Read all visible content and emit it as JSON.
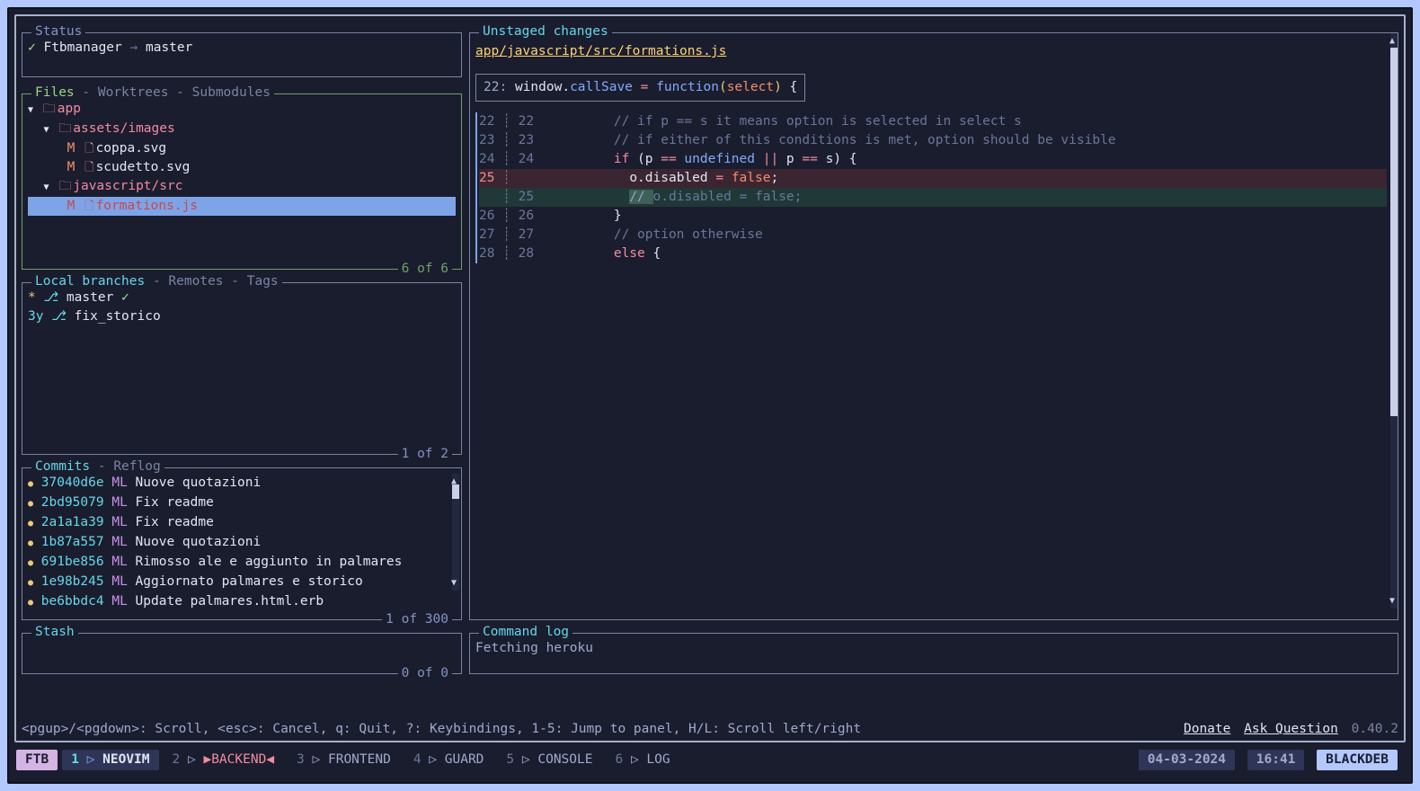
{
  "status": {
    "title": "Status",
    "repo": "Ftbmanager",
    "arrow": "→",
    "branch": "master"
  },
  "files": {
    "tabs": {
      "active": "Files",
      "t2": "Worktrees",
      "t3": "Submodules"
    },
    "counter": "6 of 6",
    "tree": {
      "app": "app",
      "assets": "assets/images",
      "coppa": "coppa.svg",
      "scudetto": "scudetto.svg",
      "jssrc": "javascript/src",
      "formations": "formations.js"
    },
    "status_m": "M"
  },
  "branches": {
    "tabs": {
      "active": "Local branches",
      "t2": "Remotes",
      "t3": "Tags"
    },
    "counter": "1 of 2",
    "items": [
      {
        "prefix": "*",
        "name": "master",
        "check": "✓",
        "age": ""
      },
      {
        "prefix": "",
        "name": "fix_storico",
        "check": "",
        "age": "3y"
      }
    ]
  },
  "commits": {
    "tabs": {
      "active": "Commits",
      "t2": "Reflog"
    },
    "counter": "1 of 300",
    "items": [
      {
        "hash": "37040d6e",
        "author": "ML",
        "msg": "Nuove quotazioni"
      },
      {
        "hash": "2bd95079",
        "author": "ML",
        "msg": "Fix readme"
      },
      {
        "hash": "2a1a1a39",
        "author": "ML",
        "msg": "Fix readme"
      },
      {
        "hash": "1b87a557",
        "author": "ML",
        "msg": "Nuove quotazioni"
      },
      {
        "hash": "691be856",
        "author": "ML",
        "msg": "Rimosso ale e aggiunto in palmares"
      },
      {
        "hash": "1e98b245",
        "author": "ML",
        "msg": "Aggiornato palmares e storico"
      },
      {
        "hash": "be6bbdc4",
        "author": "ML",
        "msg": "Update palmares.html.erb"
      }
    ]
  },
  "stash": {
    "title": "Stash",
    "counter": "0 of 0"
  },
  "diff": {
    "title": "Unstaged changes",
    "file": "app/javascript/src/formations.js",
    "hunk": {
      "ln": "22",
      "w": "window",
      "callSave": "callSave",
      "func": "function",
      "select": "select",
      "eq": " = ",
      "paren": "(",
      "paren2": ")",
      "brace": " {",
      "dot": "."
    },
    "lines": {
      "c1l": "22",
      "c1r": "22",
      "c1": "        // if p == s it means option is selected in select s",
      "c2l": "23",
      "c2r": "23",
      "c2": "        // if either of this conditions is met, option should be visible",
      "ifkw": "if",
      "ifparen": " (p ",
      "eqop": "==",
      "undef": " undefined ",
      "or": "||",
      "ps": " p ",
      "eqop2": "==",
      "s": " s) {",
      "ifl": "24",
      "ifr": "24",
      "reml": "25",
      "remprop": "o.disabled",
      "remeq": " = ",
      "remfalse": "false",
      "remsemi": ";",
      "remindent": "          ",
      "addr": "25",
      "addcomm": "// ",
      "addtxt": "o.disabled = false;",
      "addindent": "          ",
      "bl": "26",
      "br": "26",
      "bclose": "        }",
      "otl": "27",
      "otr": "27",
      "otcomm": "        // option otherwise",
      "ell": "28",
      "elr": "28",
      "elkw": "else",
      "elbr": " {",
      "elindent": "        "
    }
  },
  "cmdlog": {
    "title": "Command log",
    "text": "Fetching heroku"
  },
  "footer": {
    "keys": "<pgup>/<pgdown>: Scroll, <esc>: Cancel, q: Quit, ?: Keybindings, 1-5: Jump to panel, H/L: Scroll left/right",
    "donate": "Donate",
    "ask": "Ask Question",
    "version": "0.40.2"
  },
  "tmux": {
    "session": "FTB",
    "windows": [
      {
        "n": "1",
        "name": "NEOVIM",
        "active": true,
        "backend": false
      },
      {
        "n": "2",
        "name": "BACKEND",
        "active": false,
        "backend": true
      },
      {
        "n": "3",
        "name": "FRONTEND",
        "active": false,
        "backend": false
      },
      {
        "n": "4",
        "name": "GUARD",
        "active": false,
        "backend": false
      },
      {
        "n": "5",
        "name": "CONSOLE",
        "active": false,
        "backend": false
      },
      {
        "n": "6",
        "name": "LOG",
        "active": false,
        "backend": false
      }
    ],
    "date": "04-03-2024",
    "time": "16:41",
    "host": "BLACKDEB"
  }
}
